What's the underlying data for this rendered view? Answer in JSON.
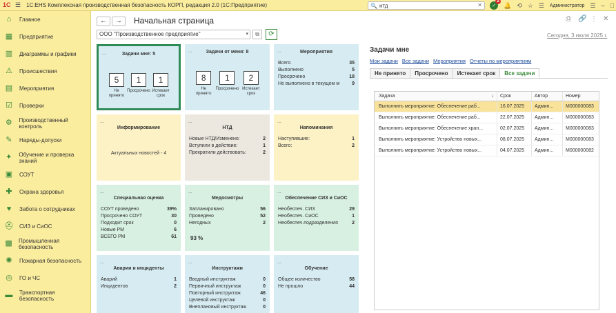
{
  "titlebar": {
    "title": "1С:EHS Комплексная производственная безопасность КОРП, редакция 2.0  (1С:Предприятие)",
    "search_value": "нтд",
    "notifications": "2",
    "user": "Администратор"
  },
  "sidebar": {
    "items": [
      {
        "label": "Главное",
        "icon": "home-icon"
      },
      {
        "label": "Предприятие",
        "icon": "enterprise-icon"
      },
      {
        "label": "Диаграммы и графики",
        "icon": "chart-icon"
      },
      {
        "label": "Происшествия",
        "icon": "incident-icon"
      },
      {
        "label": "Мероприятия",
        "icon": "calendar-icon"
      },
      {
        "label": "Проверки",
        "icon": "checklist-icon"
      },
      {
        "label": "Производственный контроль",
        "icon": "control-icon"
      },
      {
        "label": "Наряды-допуски",
        "icon": "permit-icon"
      },
      {
        "label": "Обучение и проверка знаний",
        "icon": "training-icon"
      },
      {
        "label": "СОУТ",
        "icon": "sout-icon"
      },
      {
        "label": "Охрана здоровья",
        "icon": "health-icon"
      },
      {
        "label": "Забота о сотрудниках",
        "icon": "care-icon"
      },
      {
        "label": "СИЗ и СиОС",
        "icon": "ppe-icon"
      },
      {
        "label": "Промышленная безопасность",
        "icon": "industrial-icon"
      },
      {
        "label": "Пожарная безопасность",
        "icon": "fire-icon"
      },
      {
        "label": "ГО и ЧС",
        "icon": "civil-defense-icon"
      },
      {
        "label": "Транспортная безопасность",
        "icon": "transport-icon"
      }
    ]
  },
  "page": {
    "title": "Начальная страница",
    "org": "ООО \"Производственное предприятие\"",
    "date": "Сегодня, 3 июля 2025 г."
  },
  "tiles": {
    "tasks_me": {
      "title": "Задачи мне: 5",
      "boxes": [
        {
          "value": "5",
          "label": "Не принято"
        },
        {
          "value": "1",
          "label": "Просрочено"
        },
        {
          "value": "1",
          "label": "Истекает срок"
        }
      ]
    },
    "tasks_from": {
      "title": "Задачи от меня: 8",
      "boxes": [
        {
          "value": "8",
          "label": "Не принято"
        },
        {
          "value": "1",
          "label": "Просрочено"
        },
        {
          "value": "2",
          "label": "Истекает срок"
        }
      ]
    },
    "events": {
      "title": "Мероприятия",
      "rows": [
        {
          "k": "Всего",
          "v": "35"
        },
        {
          "k": "Выполнено",
          "v": "5"
        },
        {
          "k": "Просрочено",
          "v": "18"
        },
        {
          "k": "Не выполнено в текущем м",
          "v": "9"
        }
      ]
    },
    "info": {
      "title": "Информирование",
      "text": "Актуальных новостей - 4"
    },
    "ntd": {
      "title": "НТД",
      "rows": [
        {
          "k": "Новые НТД/Изменено:",
          "v": "2"
        },
        {
          "k": "Вступили в действие:",
          "v": "1"
        },
        {
          "k": "Прекратили действовать:",
          "v": "2"
        }
      ]
    },
    "reminders": {
      "title": "Напоминания",
      "rows": [
        {
          "k": "Наступившие:",
          "v": "1"
        },
        {
          "k": "Всего:",
          "v": "2"
        }
      ]
    },
    "special": {
      "title": "Специальная оценка",
      "rows": [
        {
          "k": "СОУТ проведено",
          "v": "39%"
        },
        {
          "k": "Просрочено СОУТ",
          "v": "30"
        },
        {
          "k": "Подходит срок",
          "v": "0"
        },
        {
          "k": "Новые РМ",
          "v": "6"
        },
        {
          "k": "ВСЕГО РМ",
          "v": "61"
        }
      ]
    },
    "medical": {
      "title": "Медосмотры",
      "rows": [
        {
          "k": "Запланировано",
          "v": "56"
        },
        {
          "k": "Проведено",
          "v": "52"
        },
        {
          "k": "Негодных",
          "v": "2"
        }
      ],
      "pct": "93 %"
    },
    "ppe": {
      "title": "Обеспечение СИЗ и СиОС",
      "rows": [
        {
          "k": "Необеспеч. СИЗ",
          "v": "29"
        },
        {
          "k": "Необеспеч. СиОС",
          "v": "1"
        },
        {
          "k": "Необеспеч.подразделения",
          "v": "2"
        }
      ]
    },
    "accidents": {
      "title": "Аварии и инциденты",
      "rows": [
        {
          "k": "Аварий",
          "v": "1"
        },
        {
          "k": "Инцидентов",
          "v": "2"
        }
      ]
    },
    "briefings": {
      "title": "Инструктажи",
      "rows": [
        {
          "k": "Вводный инструктаж",
          "v": "0"
        },
        {
          "k": "Первичный инструктаж",
          "v": "0"
        },
        {
          "k": "Повторный инструктаж",
          "v": "46"
        },
        {
          "k": "Целевой инструктаж",
          "v": "0"
        },
        {
          "k": "Внеплановый инструктаж",
          "v": "0"
        }
      ]
    },
    "training": {
      "title": "Обучение",
      "rows": [
        {
          "k": "Общее количество",
          "v": "58"
        },
        {
          "k": "Не прошло",
          "v": "44"
        }
      ]
    }
  },
  "tasks": {
    "heading": "Задачи мне",
    "links": [
      "Мои задачи",
      "Все задачи",
      "Мероприятия",
      "Отчеты по мероприятиям"
    ],
    "tabs": [
      "Не принято",
      "Просрочено",
      "Истекает срок",
      "Все задачи"
    ],
    "columns": [
      "Задача",
      "Срок",
      "Автор",
      "Номер"
    ],
    "rows": [
      [
        "Выполнить мероприятие: Обеспечение раб...",
        "16.07.2025",
        "Админ...",
        "М000000083"
      ],
      [
        "Выполнить мероприятие: Обеспечение раб...",
        "22.07.2025",
        "Админ...",
        "М000000083"
      ],
      [
        "Выполнить мероприятие: Обеспечение хран...",
        "02.07.2025",
        "Админ...",
        "М000000083"
      ],
      [
        "Выполнить мероприятие: Устройство новых...",
        "08.07.2025",
        "Админ...",
        "М000000083"
      ],
      [
        "Выполнить мероприятие: Устройство новых...",
        "04.07.2025",
        "Админ...",
        "М000000082"
      ]
    ]
  }
}
